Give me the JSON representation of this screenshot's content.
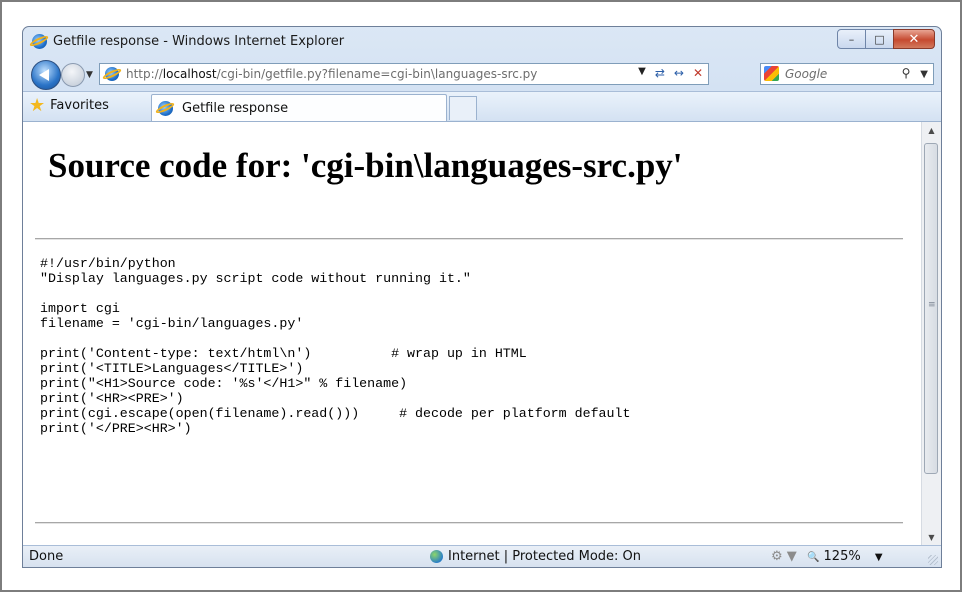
{
  "window": {
    "title": "Getfile response - Windows Internet Explorer",
    "controls": {
      "minimize": "–",
      "maximize": "□",
      "close": "✕"
    }
  },
  "address_bar": {
    "url_prefix": "http://",
    "url_host": "localhost",
    "url_path": "/cgi-bin/getfile.py?filename=cgi-bin\\languages-src.py",
    "dropdown": "▼",
    "refresh": "⇄",
    "redirect": "↔",
    "stop": "✕"
  },
  "search": {
    "placeholder": "Google",
    "icon": "⚲",
    "dropdown": "▼"
  },
  "favorites": {
    "label": "Favorites"
  },
  "tabs": [
    {
      "label": "Getfile response",
      "active": true
    }
  ],
  "page": {
    "heading": "Source code for: 'cgi-bin\\languages-src.py'",
    "code_lines": [
      "#!/usr/bin/python",
      "\"Display languages.py script code without running it.\"",
      "",
      "import cgi",
      "filename = 'cgi-bin/languages.py'",
      "",
      "print('Content-type: text/html\\n')          # wrap up in HTML",
      "print('<TITLE>Languages</TITLE>')",
      "print(\"<H1>Source code: '%s'</H1>\" % filename)",
      "print('<HR><PRE>')",
      "print(cgi.escape(open(filename).read()))     # decode per platform default",
      "print('</PRE><HR>')"
    ]
  },
  "status_bar": {
    "status": "Done",
    "zone": "Internet | Protected Mode: On",
    "zoom": "125%",
    "zoom_icon": "🔍",
    "dropdown": "▼"
  },
  "colors": {
    "title_gradient": "#c3d6ee",
    "close_button": "#c64a30",
    "text": "#000000"
  }
}
